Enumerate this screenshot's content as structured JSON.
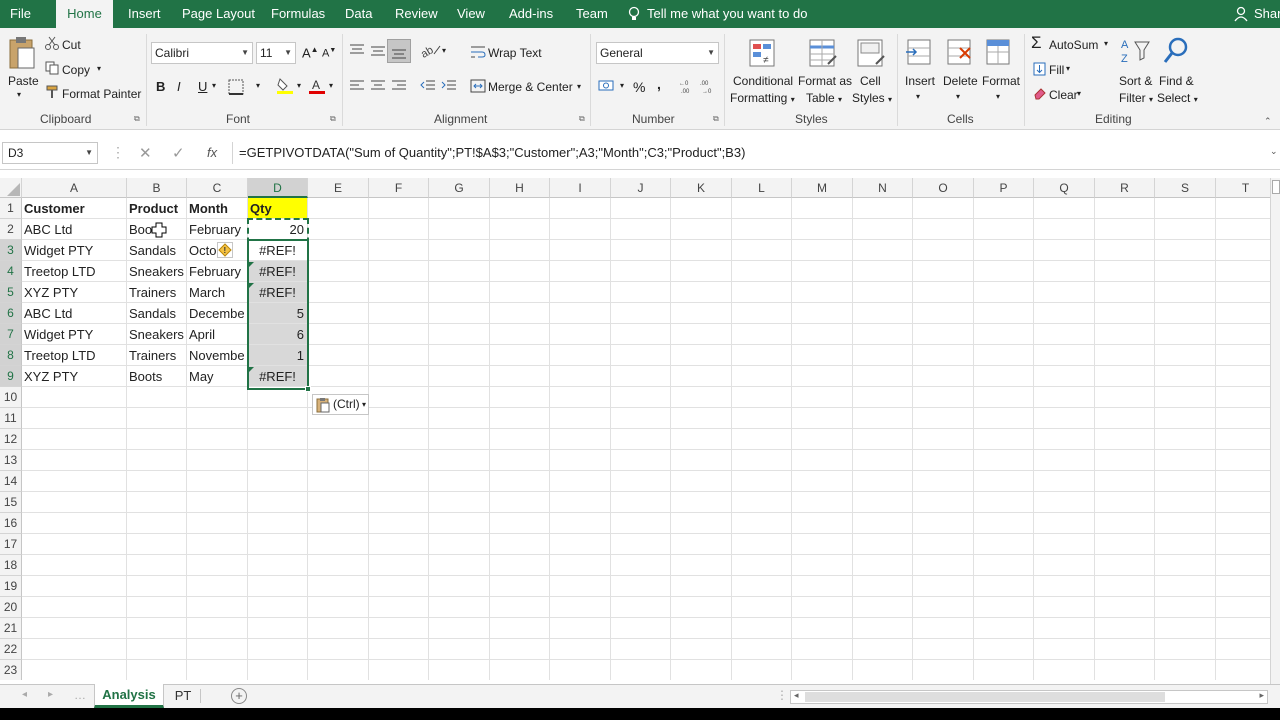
{
  "menu": {
    "tabs": [
      "File",
      "Home",
      "Insert",
      "Page Layout",
      "Formulas",
      "Data",
      "Review",
      "View",
      "Add-ins",
      "Team"
    ],
    "tell_me": "Tell me what you want to do",
    "share": "Shar"
  },
  "ribbon": {
    "clipboard": {
      "paste": "Paste",
      "cut": "Cut",
      "copy": "Copy",
      "format_painter": "Format Painter",
      "label": "Clipboard"
    },
    "font": {
      "name": "Calibri",
      "size": "11",
      "bold": "B",
      "italic": "I",
      "underline": "U",
      "label": "Font"
    },
    "alignment": {
      "wrap": "Wrap Text",
      "merge": "Merge & Center",
      "label": "Alignment"
    },
    "number": {
      "format": "General",
      "percent": "%",
      "comma": ",",
      "label": "Number"
    },
    "styles": {
      "conditional_1": "Conditional",
      "conditional_2": "Formatting",
      "format_as_1": "Format as",
      "format_as_2": "Table",
      "cell_1": "Cell",
      "cell_2": "Styles",
      "label": "Styles"
    },
    "cells": {
      "insert": "Insert",
      "delete": "Delete",
      "format": "Format",
      "label": "Cells"
    },
    "editing": {
      "autosum": "AutoSum",
      "fill": "Fill",
      "clear": "Clear",
      "sort_1": "Sort &",
      "sort_2": "Filter",
      "find_1": "Find &",
      "find_2": "Select",
      "label": "Editing"
    }
  },
  "formula_bar": {
    "name_box": "D3",
    "fx": "fx",
    "formula": "=GETPIVOTDATA(\"Sum of Quantity\";PT!$A$3;\"Customer\";A3;\"Month\";C3;\"Product\";B3)"
  },
  "grid": {
    "columns": [
      "A",
      "B",
      "C",
      "D",
      "E",
      "F",
      "G",
      "H",
      "I",
      "J",
      "K",
      "L",
      "M",
      "N",
      "O",
      "P",
      "Q",
      "R",
      "S",
      "T"
    ],
    "rows": [
      "1",
      "2",
      "3",
      "4",
      "5",
      "6",
      "7",
      "8",
      "9",
      "10",
      "11",
      "12",
      "13",
      "14",
      "15",
      "16",
      "17",
      "18",
      "19",
      "20",
      "21",
      "22",
      "23"
    ],
    "header": {
      "customer": "Customer",
      "product": "Product",
      "month": "Month",
      "qty": "Qty"
    },
    "data": [
      [
        "ABC Ltd",
        "Boo",
        "February",
        "20"
      ],
      [
        "Widget PTY",
        "Sandals",
        "Octo",
        "#REF!"
      ],
      [
        "Treetop LTD",
        "Sneakers",
        "February",
        "#REF!"
      ],
      [
        "XYZ PTY",
        "Trainers",
        "March",
        "#REF!"
      ],
      [
        "ABC Ltd",
        "Sandals",
        "Decembe",
        "5"
      ],
      [
        "Widget PTY",
        "Sneakers",
        "April",
        "6"
      ],
      [
        "Treetop LTD",
        "Trainers",
        "Novembe",
        "1"
      ],
      [
        "XYZ PTY",
        "Boots",
        "May",
        "#REF!"
      ]
    ],
    "paste_options": "(Ctrl)"
  },
  "sheets": {
    "tabs": [
      "Analysis",
      "PT"
    ],
    "active": "Analysis"
  },
  "colors": {
    "excel_green": "#217346",
    "highlight_yellow": "#ffff00"
  }
}
